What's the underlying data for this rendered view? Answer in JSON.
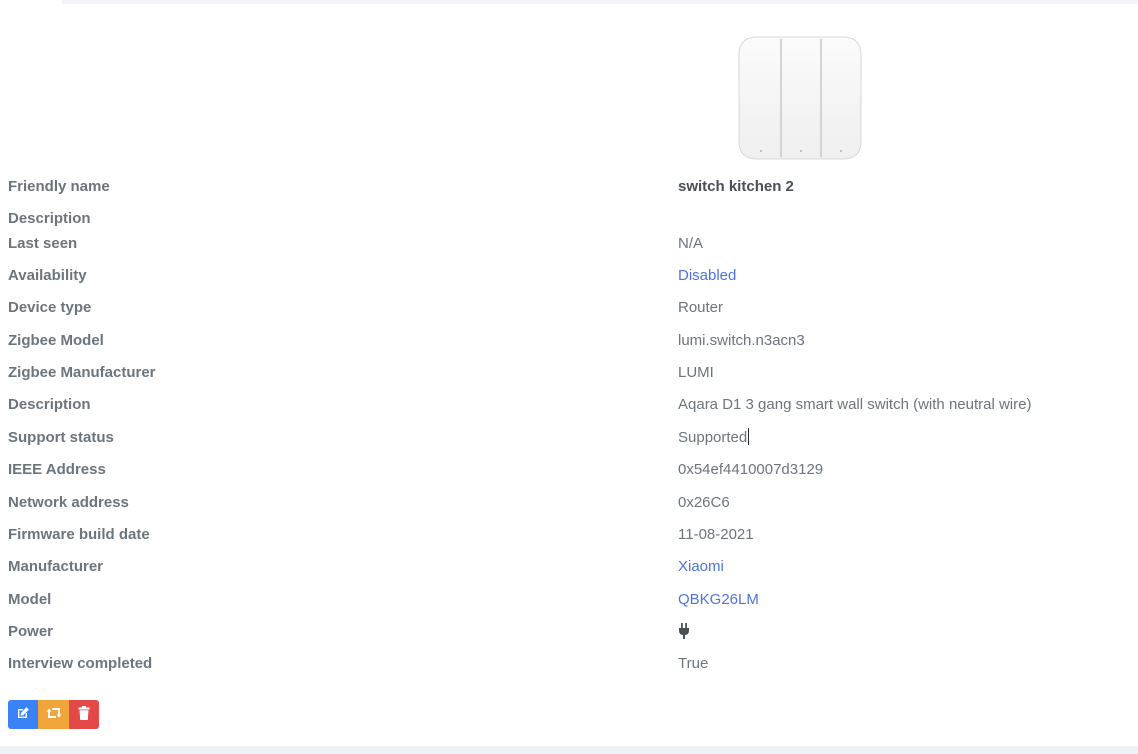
{
  "device": {
    "image_alt": "Aqara D1 3 gang smart wall switch",
    "rows": [
      {
        "label": "Friendly name",
        "value": "switch kitchen 2"
      },
      {
        "label": "Description",
        "value": ""
      },
      {
        "label": "Last seen",
        "value": "N/A"
      },
      {
        "label": "Availability",
        "value": "Disabled"
      },
      {
        "label": "Device type",
        "value": "Router"
      },
      {
        "label": "Zigbee Model",
        "value": "lumi.switch.n3acn3"
      },
      {
        "label": "Zigbee Manufacturer",
        "value": "LUMI"
      },
      {
        "label": "Description",
        "value": "Aqara D1 3 gang smart wall switch (with neutral wire)"
      },
      {
        "label": "Support status",
        "value": "Supported"
      },
      {
        "label": "IEEE Address",
        "value": "0x54ef4410007d3129"
      },
      {
        "label": "Network address",
        "value": "0x26C6"
      },
      {
        "label": "Firmware build date",
        "value": "11-08-2021"
      },
      {
        "label": "Manufacturer",
        "value": "Xiaomi"
      },
      {
        "label": "Model",
        "value": "QBKG26LM"
      },
      {
        "label": "Power",
        "value": "plug-icon"
      },
      {
        "label": "Interview completed",
        "value": "True"
      }
    ]
  },
  "actions": {
    "edit_icon": "edit-icon",
    "reconfigure_icon": "retweet-icon",
    "remove_icon": "trash-icon"
  },
  "colors": {
    "link": "#4e73df",
    "supported": "#34b15a",
    "edit_button": "#3b82f6",
    "reconfigure_button": "#f0a53a",
    "remove_button": "#e54848"
  }
}
